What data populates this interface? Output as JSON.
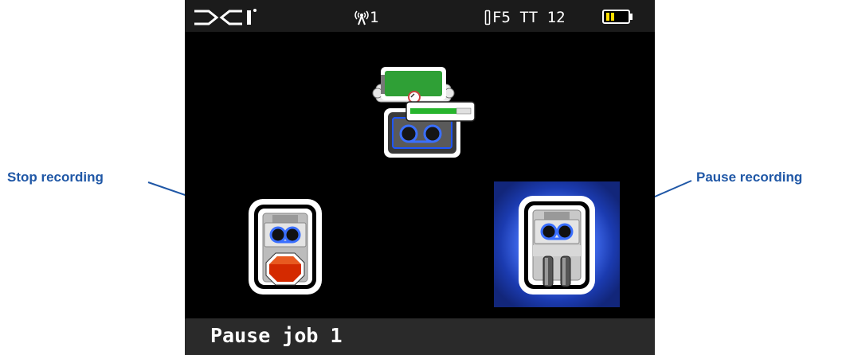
{
  "callouts": {
    "stop_recording": "Stop recording",
    "pause_recording": "Pause recording"
  },
  "status_bar": {
    "logo": "DCI",
    "signal_icon": "antenna-icon",
    "channel": "1",
    "frequency_text": "F5 TT 12",
    "battery_icon": "battery-icon"
  },
  "menu": {
    "title": "Pause job 1",
    "options": [
      {
        "name": "current-job-status",
        "icon": "job-recorder-icon"
      },
      {
        "name": "stop-recording",
        "icon": "stop-recording-icon"
      },
      {
        "name": "pause-recording",
        "icon": "pause-recording-icon",
        "selected": true
      }
    ]
  },
  "colors": {
    "callout_text": "#1f57a6",
    "screen_background": "#000000",
    "selection_highlight": "#1a3aa8",
    "battery": "#ffdd00",
    "stop_sign": "#d42a00",
    "tape_reels": "#3a6fff"
  }
}
